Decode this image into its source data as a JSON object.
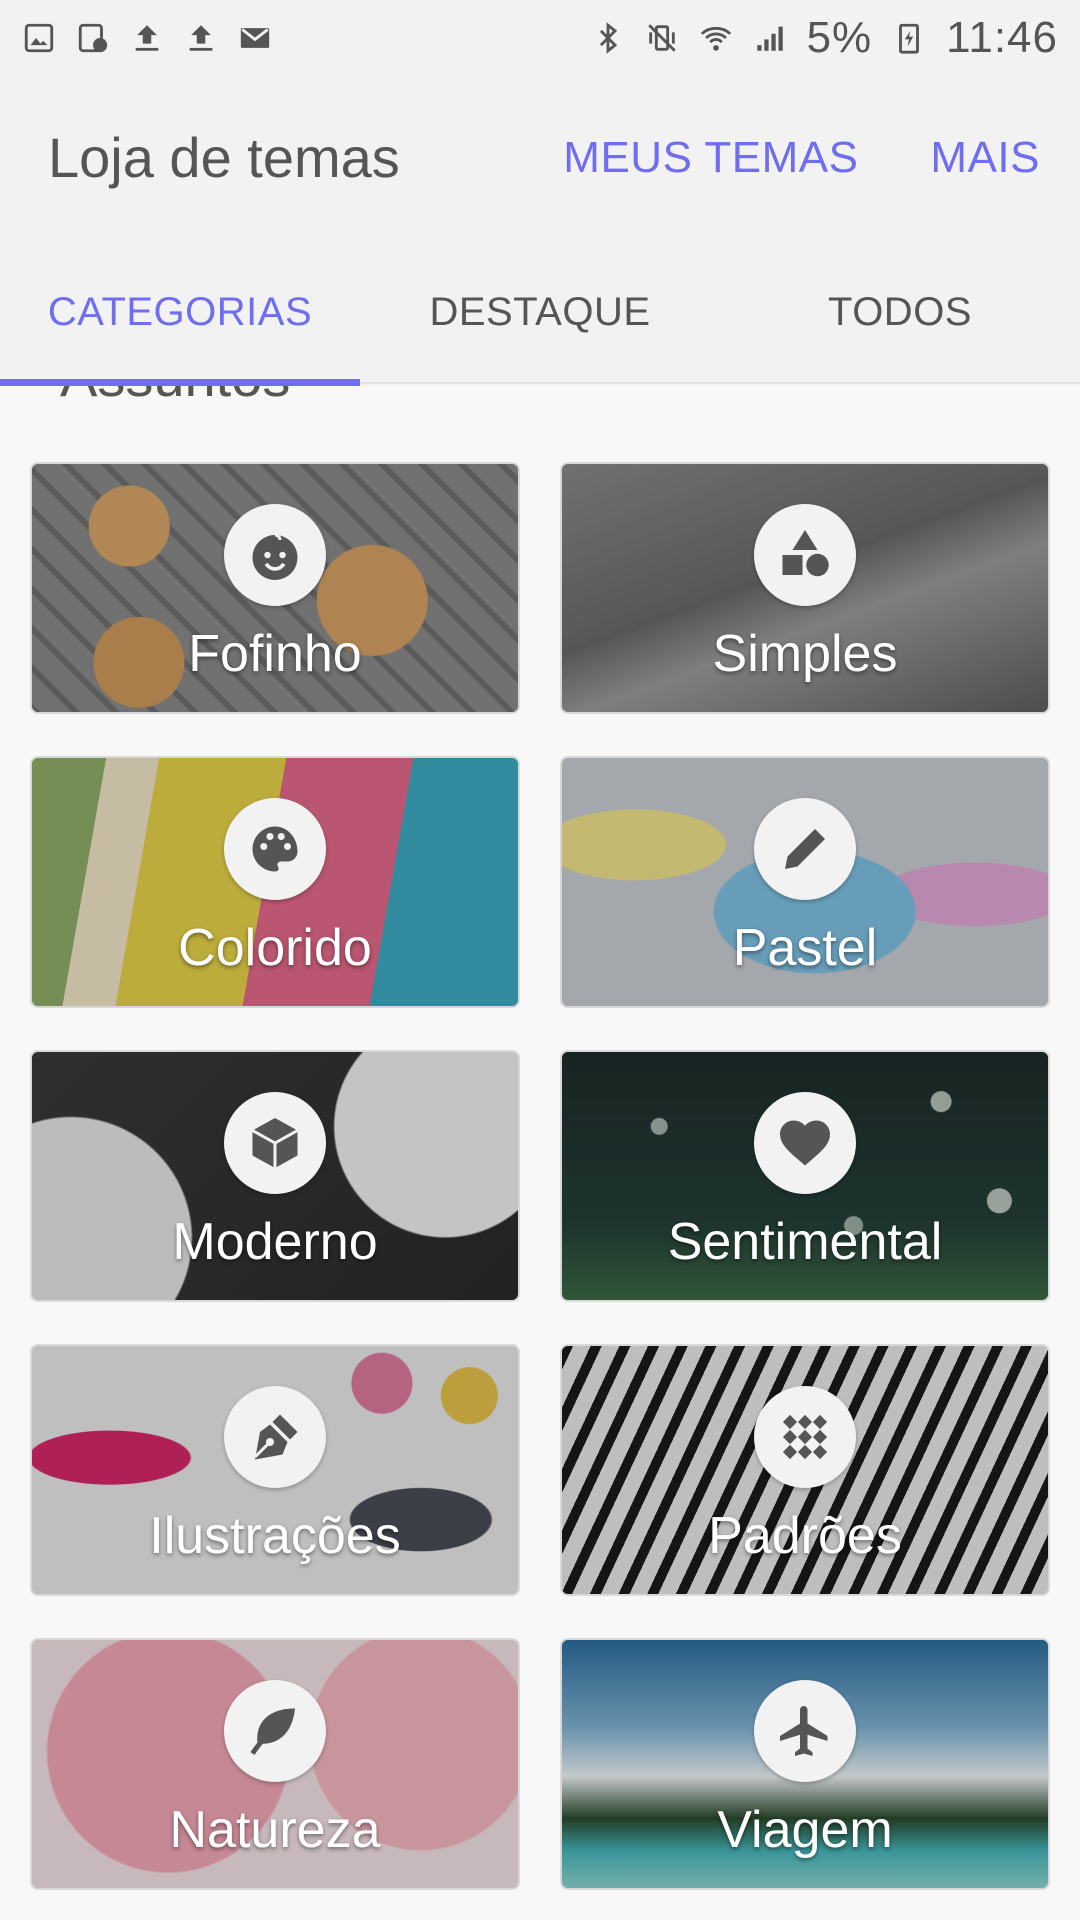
{
  "status_bar": {
    "battery": "5%",
    "time": "11:46",
    "left_icons": [
      "image-icon",
      "screenshot-icon",
      "upload-icon",
      "upload-icon",
      "mail-icon"
    ],
    "right_icons": [
      "bluetooth-icon",
      "vibrate-icon",
      "wifi-icon",
      "signal-icon",
      "battery-charging-icon"
    ]
  },
  "app_bar": {
    "title": "Loja de temas",
    "actions": [
      "MEUS TEMAS",
      "MAIS"
    ]
  },
  "tabs": [
    {
      "label": "CATEGORIAS",
      "active": true
    },
    {
      "label": "DESTAQUE",
      "active": false
    },
    {
      "label": "TODOS",
      "active": false
    }
  ],
  "section": {
    "title": "Assuntos"
  },
  "categories": [
    {
      "label": "Fofinho",
      "icon": "baby-face-icon"
    },
    {
      "label": "Simples",
      "icon": "shapes-icon"
    },
    {
      "label": "Colorido",
      "icon": "palette-icon"
    },
    {
      "label": "Pastel",
      "icon": "pencil-icon"
    },
    {
      "label": "Moderno",
      "icon": "cube-icon"
    },
    {
      "label": "Sentimental",
      "icon": "heart-icon"
    },
    {
      "label": "Ilustrações",
      "icon": "pen-nib-icon"
    },
    {
      "label": "Padrões",
      "icon": "pattern-icon"
    },
    {
      "label": "Natureza",
      "icon": "leaf-icon"
    },
    {
      "label": "Viagem",
      "icon": "airplane-icon"
    }
  ],
  "colors": {
    "accent": "#6f6ef0",
    "text": "#555555",
    "background": "#f2f2f3"
  }
}
